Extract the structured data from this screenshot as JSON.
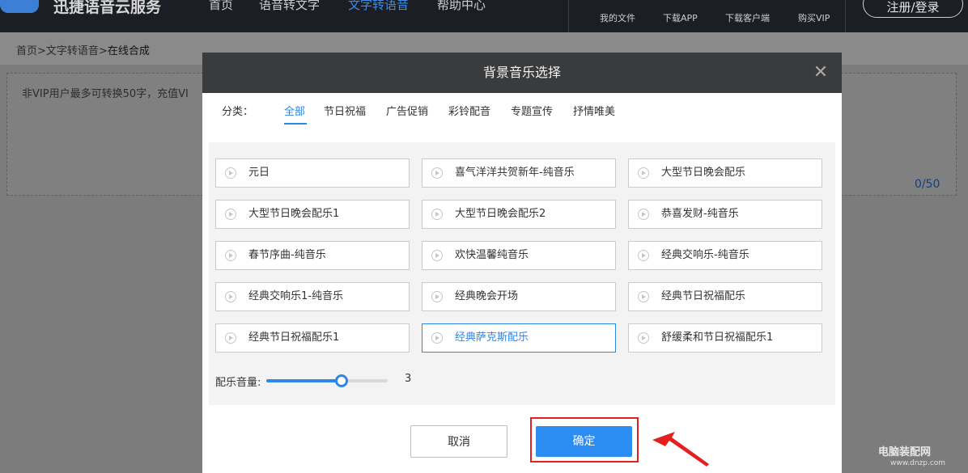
{
  "header": {
    "brand": "迅捷语音云服务",
    "nav": [
      {
        "label": "首页"
      },
      {
        "label": "语音转文字"
      },
      {
        "label": "文字转语音",
        "active": true
      },
      {
        "label": "帮助中心"
      }
    ],
    "utils": [
      {
        "label": "我的文件"
      },
      {
        "label": "下载APP"
      },
      {
        "label": "下载客户端"
      },
      {
        "label": "购买VIP"
      }
    ],
    "register_login": "注册/登录"
  },
  "breadcrumb": {
    "part1": "首页",
    "sep": ">",
    "part2": "文字转语音",
    "current": "在线合成"
  },
  "editor": {
    "notice": "非VIP用户最多可转换50字，充值VI",
    "counter": "0/50"
  },
  "modal": {
    "title": "背景音乐选择",
    "close_icon": "close-icon",
    "category_label": "分类：",
    "categories": [
      {
        "label": "全部",
        "active": true
      },
      {
        "label": "节日祝福"
      },
      {
        "label": "广告促销"
      },
      {
        "label": "彩铃配音"
      },
      {
        "label": "专题宣传"
      },
      {
        "label": "抒情唯美"
      }
    ],
    "tracks": [
      {
        "name": "元日"
      },
      {
        "name": "喜气洋洋共贺新年-纯音乐"
      },
      {
        "name": "大型节日晚会配乐"
      },
      {
        "name": "大型节日晚会配乐1"
      },
      {
        "name": "大型节日晚会配乐2"
      },
      {
        "name": "恭喜发财-纯音乐"
      },
      {
        "name": "春节序曲-纯音乐"
      },
      {
        "name": "欢快温馨纯音乐"
      },
      {
        "name": "经典交响乐-纯音乐"
      },
      {
        "name": "经典交响乐1-纯音乐"
      },
      {
        "name": "经典晚会开场"
      },
      {
        "name": "经典节日祝福配乐"
      },
      {
        "name": "经典节日祝福配乐1"
      },
      {
        "name": "经典萨克斯配乐",
        "selected": true
      },
      {
        "name": "舒缓柔和节日祝福配乐1"
      }
    ],
    "volume_label": "配乐音量:",
    "volume_value": "3",
    "volume_fraction": 0.62,
    "cancel_label": "取消",
    "confirm_label": "确定"
  },
  "colors": {
    "accent": "#2f86e5",
    "confirm_bg": "#2b8cf2",
    "highlight": "#e32020"
  },
  "watermark": {
    "main": "电脑装配网",
    "sub": "www.dnzp.com"
  }
}
